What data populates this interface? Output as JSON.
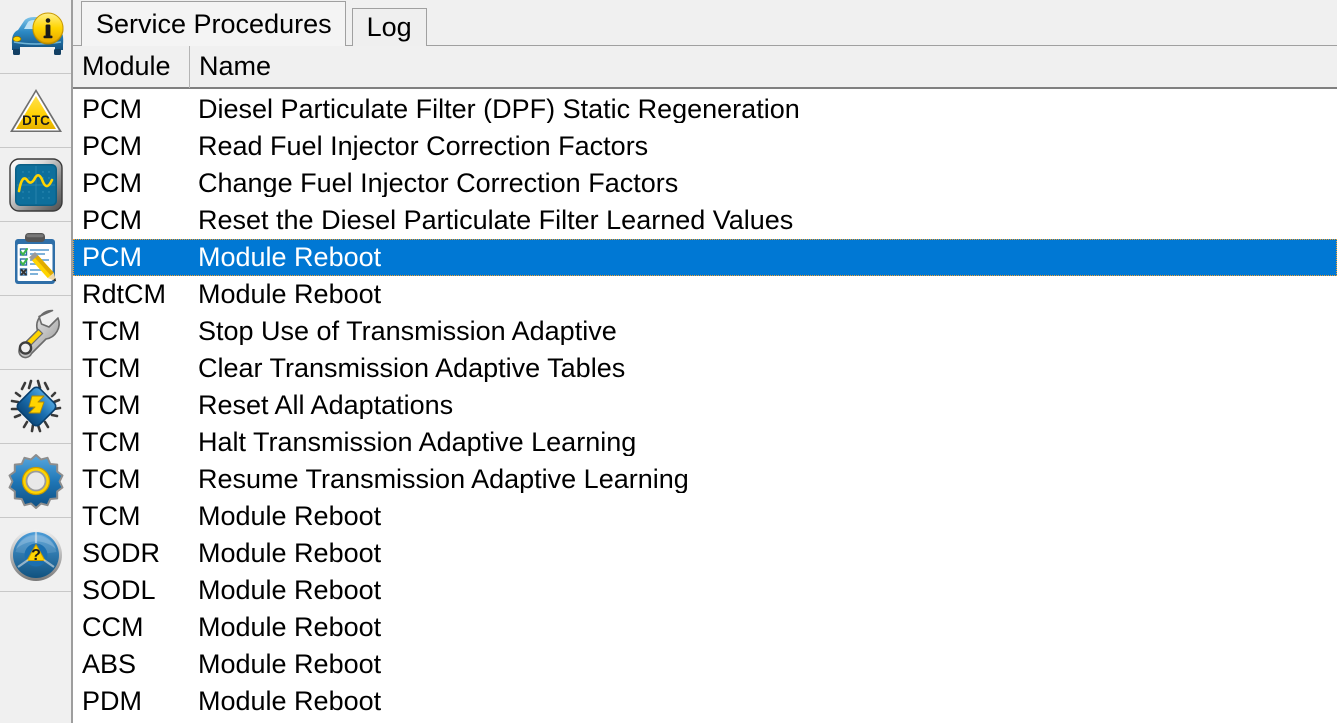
{
  "sidebar": {
    "items": [
      {
        "name": "vehicle-info-icon",
        "label": "Vehicle Information"
      },
      {
        "name": "dtc-warning-icon",
        "label": "DTC"
      },
      {
        "name": "oscilloscope-icon",
        "label": "Live Data Graph"
      },
      {
        "name": "checklist-edit-icon",
        "label": "Test Report"
      },
      {
        "name": "wrench-icon",
        "label": "Service Procedures"
      },
      {
        "name": "ecu-chip-icon",
        "label": "Module Programming"
      },
      {
        "name": "gear-settings-icon",
        "label": "Settings"
      },
      {
        "name": "steering-wheel-help-icon",
        "label": "Help"
      }
    ]
  },
  "tabs": [
    {
      "label": "Service Procedures",
      "selected": true
    },
    {
      "label": "Log",
      "selected": false
    }
  ],
  "table": {
    "columns": [
      "Module",
      "Name"
    ],
    "rows": [
      {
        "module": "PCM",
        "name": "Diesel Particulate Filter (DPF) Static Regeneration",
        "selected": false
      },
      {
        "module": "PCM",
        "name": "Read Fuel Injector Correction Factors",
        "selected": false
      },
      {
        "module": "PCM",
        "name": "Change Fuel Injector Correction Factors",
        "selected": false
      },
      {
        "module": "PCM",
        "name": "Reset the Diesel Particulate Filter Learned Values",
        "selected": false
      },
      {
        "module": "PCM",
        "name": "Module Reboot",
        "selected": true
      },
      {
        "module": "RdtCM",
        "name": "Module Reboot",
        "selected": false
      },
      {
        "module": "TCM",
        "name": "Stop Use of Transmission Adaptive",
        "selected": false
      },
      {
        "module": "TCM",
        "name": "Clear Transmission Adaptive Tables",
        "selected": false
      },
      {
        "module": "TCM",
        "name": "Reset All Adaptations",
        "selected": false
      },
      {
        "module": "TCM",
        "name": "Halt Transmission Adaptive Learning",
        "selected": false
      },
      {
        "module": "TCM",
        "name": "Resume Transmission Adaptive Learning",
        "selected": false
      },
      {
        "module": "TCM",
        "name": "Module Reboot",
        "selected": false
      },
      {
        "module": "SODR",
        "name": "Module Reboot",
        "selected": false
      },
      {
        "module": "SODL",
        "name": "Module Reboot",
        "selected": false
      },
      {
        "module": "CCM",
        "name": "Module Reboot",
        "selected": false
      },
      {
        "module": "ABS",
        "name": "Module Reboot",
        "selected": false
      },
      {
        "module": "PDM",
        "name": "Module Reboot",
        "selected": false
      }
    ]
  },
  "colors": {
    "selection": "#0078d4",
    "selection_text": "#ffffff",
    "chrome": "#f0f0f0",
    "list_bg": "#ffffff",
    "accent_yellow": "#ffd200",
    "accent_blue": "#1b6fb0"
  }
}
